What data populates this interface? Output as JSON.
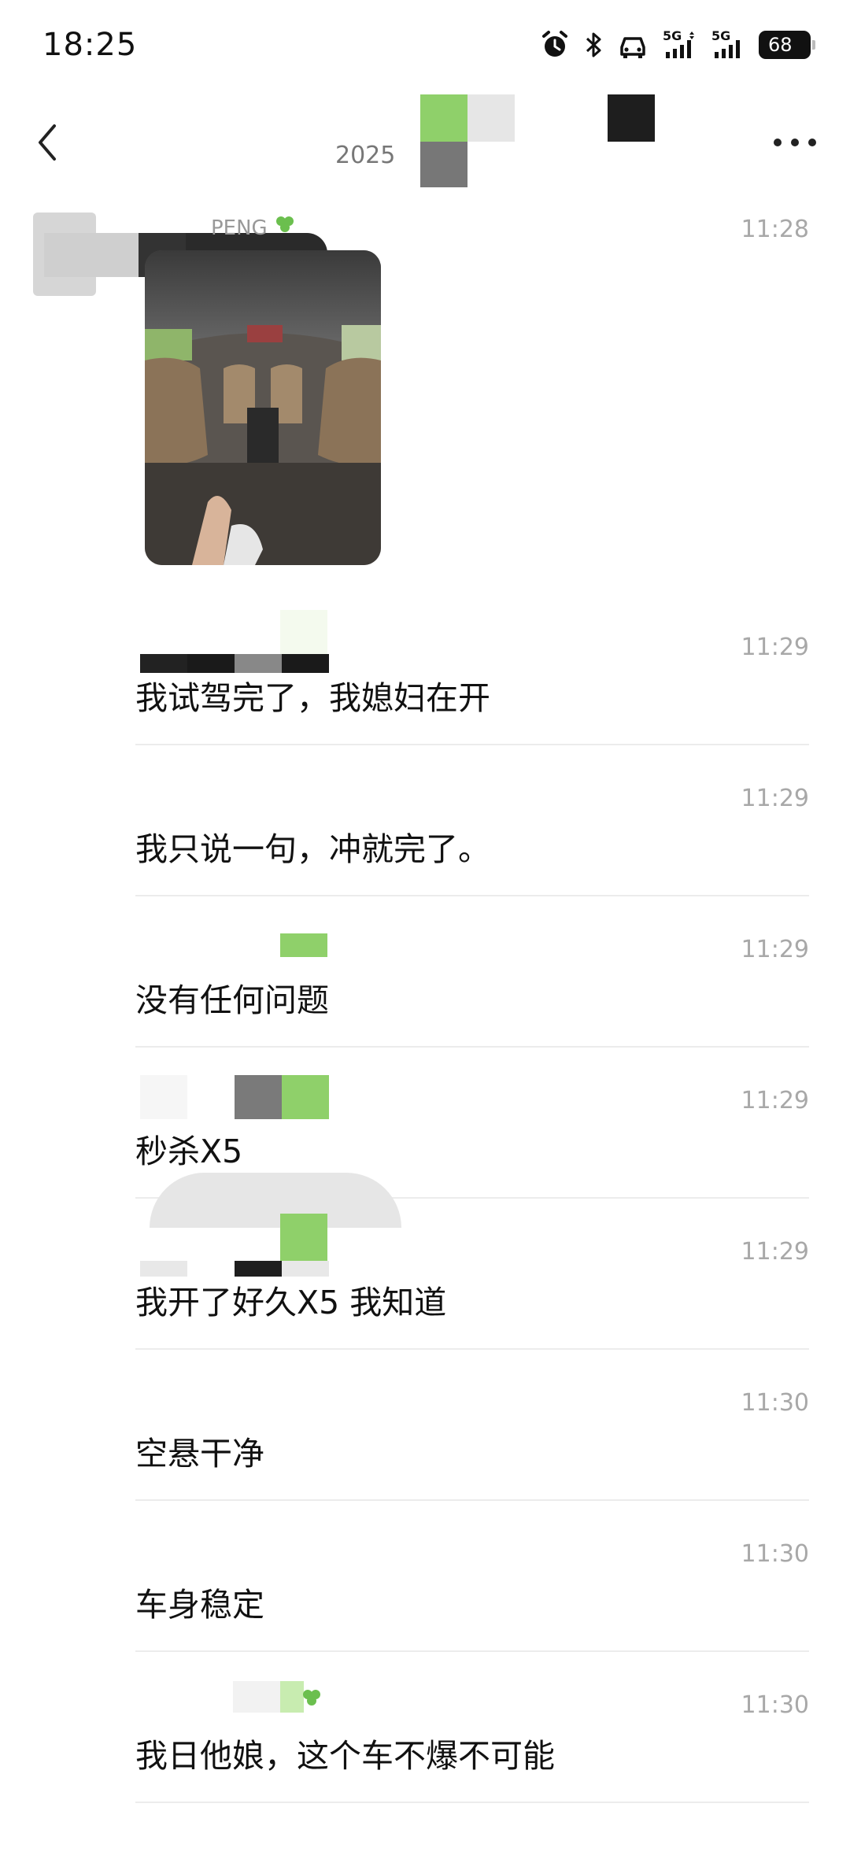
{
  "status_bar": {
    "time": "18:25",
    "battery": "68",
    "signal_labels": [
      "5G",
      "5G"
    ],
    "icons": [
      "alarm-icon",
      "bluetooth-icon",
      "car-icon",
      "signal-icon",
      "signal-icon",
      "battery-icon"
    ]
  },
  "nav": {
    "back_icon": "chevron-left-icon",
    "more_icon": "more-dots-icon",
    "subtitle": "2025"
  },
  "first_message": {
    "sender": "PENG",
    "time": "11:28",
    "image": "car-interior-photo"
  },
  "messages": [
    {
      "time": "11:29",
      "text": "我试驾完了，我媳妇在开"
    },
    {
      "time": "11:29",
      "text": "我只说一句，冲就完了。"
    },
    {
      "time": "11:29",
      "text": "没有任何问题"
    },
    {
      "time": "11:29",
      "text": "秒杀X5"
    },
    {
      "time": "11:29",
      "text": "我开了好久X5 我知道"
    },
    {
      "time": "11:30",
      "text": "空悬干净"
    },
    {
      "time": "11:30",
      "text": "车身稳定"
    },
    {
      "time": "11:30",
      "text": "我日他娘，这个车不爆不可能"
    }
  ],
  "colors": {
    "time_gray": "#a8a8a8",
    "divider": "#ececec",
    "mosaic_green": "#8fd06a",
    "mosaic_dark": "#1e1e1e"
  }
}
